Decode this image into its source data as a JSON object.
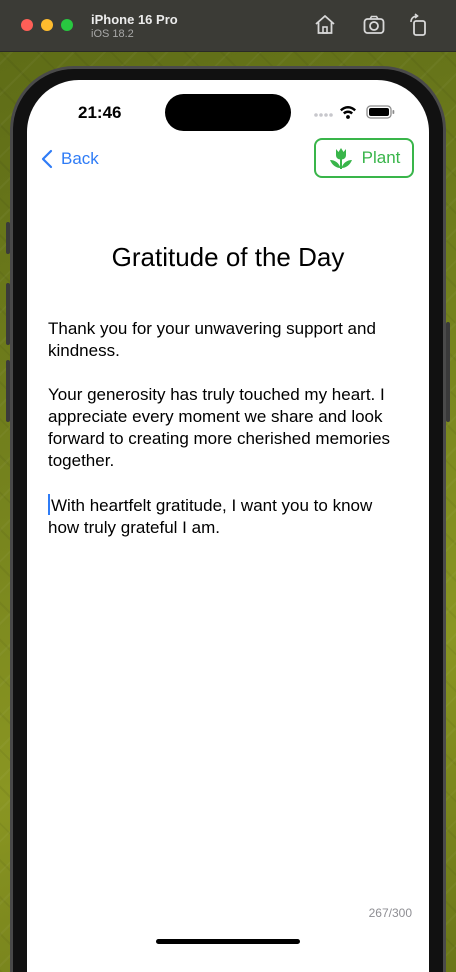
{
  "simulator": {
    "device_name": "iPhone 16 Pro",
    "os_version": "iOS 18.2",
    "icons": [
      "home-icon",
      "screenshot-icon",
      "rotate-icon"
    ]
  },
  "status_bar": {
    "time": "21:46",
    "icons": [
      "signal-dots-icon",
      "wifi-icon",
      "battery-icon"
    ]
  },
  "nav": {
    "back_label": "Back",
    "plant_label": "Plant",
    "accent_color": "#2f7cf6",
    "plant_color": "#39b54a"
  },
  "content": {
    "title": "Gratitude of the Day",
    "paragraphs": [
      "Thank you for your unwavering support and kindness.",
      "Your generosity has truly touched my heart. I appreciate every moment we share and look forward to creating more cherished memories together.",
      "With heartfelt gratitude, I want you to know how truly grateful I am."
    ],
    "char_count": "267/300"
  }
}
